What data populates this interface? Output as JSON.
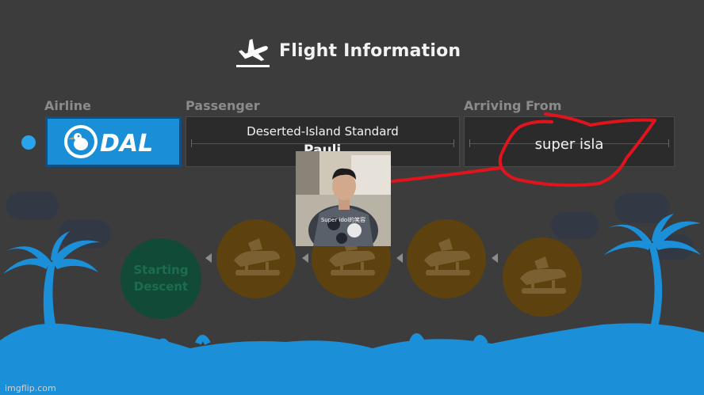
{
  "header": {
    "title": "Flight Information",
    "icon": "airplane-takeoff-icon"
  },
  "columns": {
    "airline": "Airline",
    "passenger": "Passenger",
    "arriving": "Arriving From"
  },
  "airline": {
    "logo_text": "DAL",
    "logo": "dal-dodo-logo"
  },
  "passenger": {
    "title": "Deserted-Island Standard",
    "name": "Pauli"
  },
  "arriving_from": {
    "value": "super isla"
  },
  "overlay": {
    "caption": "Super idol的笑容"
  },
  "progress": {
    "first_label": "Starting Descent",
    "steps": [
      "seaplane-icon",
      "seaplane-icon",
      "seaplane-icon",
      "seaplane-icon"
    ]
  },
  "watermark": {
    "text": "imgflip.com"
  },
  "colors": {
    "background": "#3c3c3d",
    "accent": "#1a8ed6",
    "palm": "#1b8fd8",
    "annotation": "#e0141c",
    "step": "#5d420f",
    "start": "#114a36"
  }
}
